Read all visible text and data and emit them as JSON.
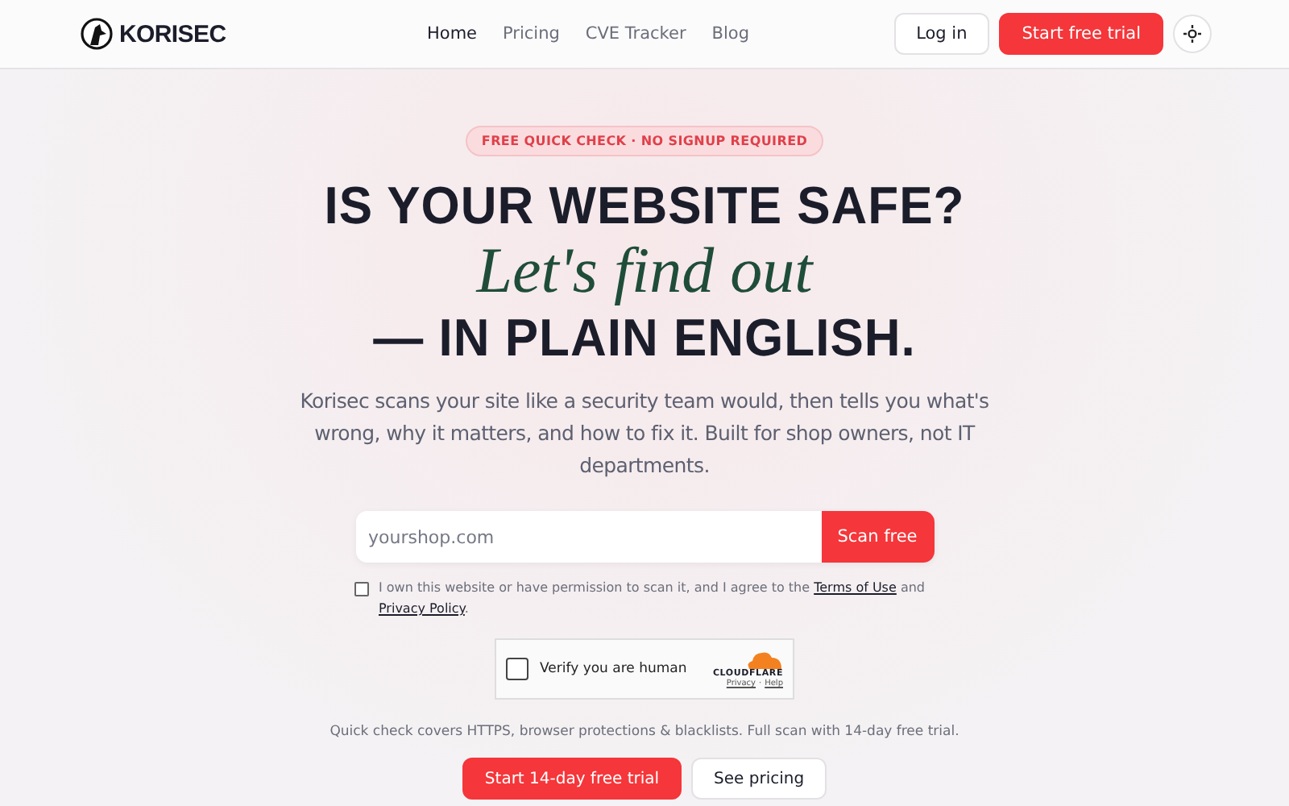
{
  "header": {
    "logo": "KORISEC",
    "nav": [
      {
        "label": "Home",
        "selected": true
      },
      {
        "label": "Pricing",
        "selected": false
      },
      {
        "label": "CVE Tracker",
        "selected": false
      },
      {
        "label": "Blog",
        "selected": false
      }
    ],
    "login": "Log in",
    "cta": "Start free trial"
  },
  "hero": {
    "badge": "FREE QUICK CHECK · NO SIGNUP REQUIRED",
    "line1": "IS YOUR WEBSITE SAFE?",
    "line2": "Let's find out",
    "line3": "— IN PLAIN ENGLISH.",
    "intro": "Korisec scans your site like a security team would, then tells you what's wrong, why it matters, and how to fix it. Built for shop owners, not IT departments."
  },
  "scan": {
    "placeholder": "yourshop.com",
    "button": "Scan free"
  },
  "consent": {
    "checked": false,
    "text": "I own this website or have permission to scan it, and I agree to the",
    "terms": "Terms of Use",
    "and": "and",
    "privacy": "Privacy Policy",
    "end": "."
  },
  "captcha": {
    "checked": false,
    "label": "Verify you are human",
    "brand": "CLOUDFLARE",
    "privacy": "Privacy",
    "sep": "·",
    "help": "Help"
  },
  "note": "Quick check covers HTTPS, browser protections & blacklists. Full scan with 14-day free trial.",
  "actions": {
    "primary": "Start 14-day free trial",
    "secondary": "See pricing"
  }
}
